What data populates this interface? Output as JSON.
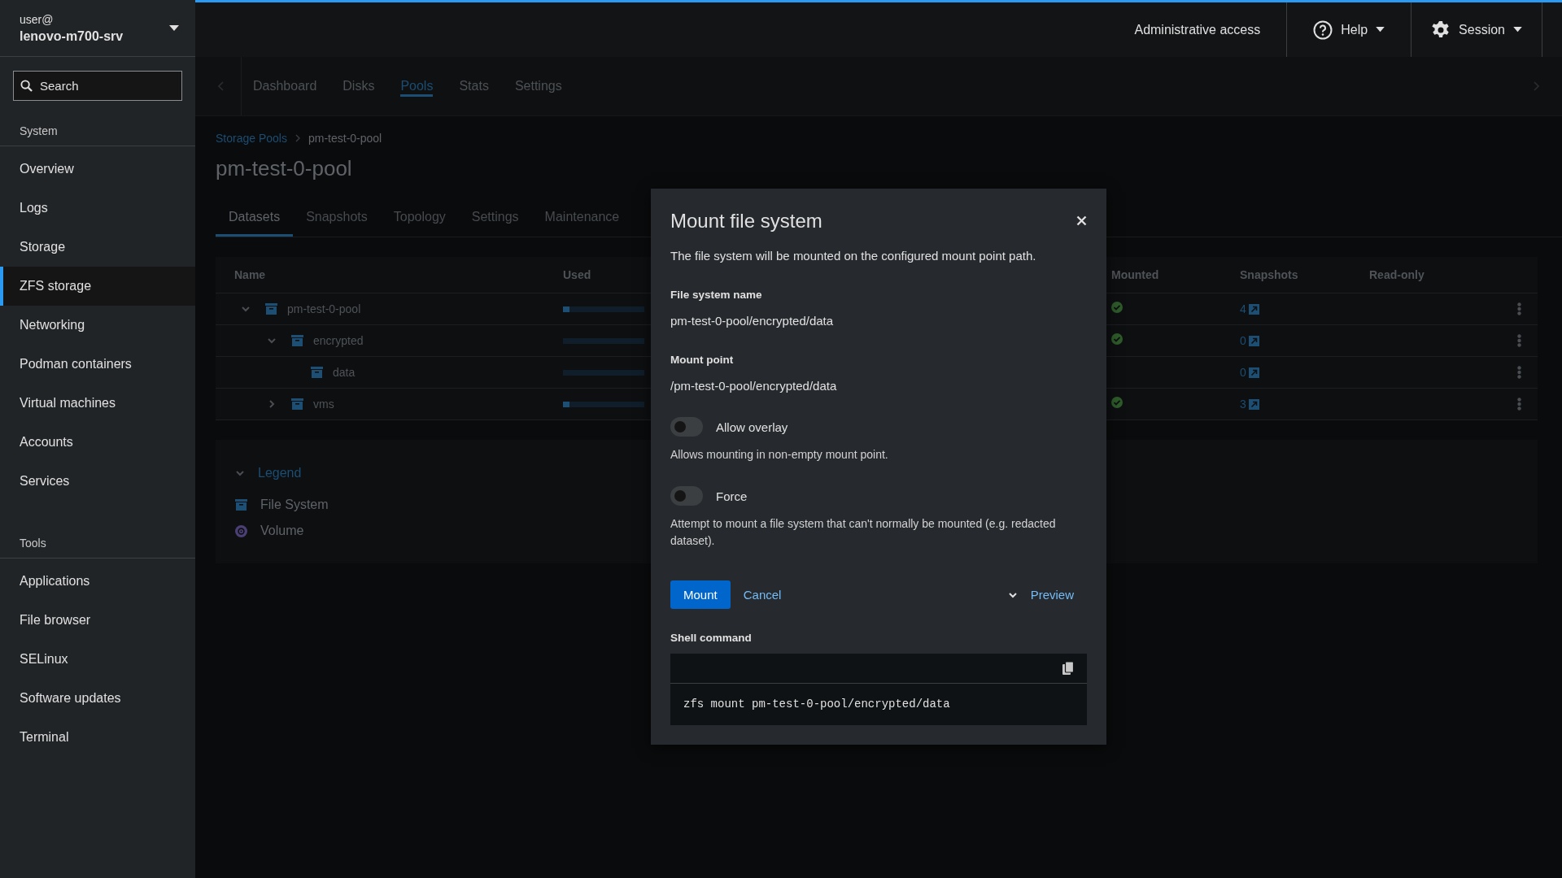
{
  "sidebar": {
    "user": "user@",
    "host": "lenovo-m700-srv",
    "search": {
      "placeholder": "Search"
    },
    "sections": [
      {
        "heading": "System",
        "items": [
          {
            "label": "Overview",
            "selected": false
          },
          {
            "label": "Logs",
            "selected": false
          },
          {
            "label": "Storage",
            "selected": false
          },
          {
            "label": "ZFS storage",
            "selected": true
          },
          {
            "label": "Networking",
            "selected": false
          },
          {
            "label": "Podman containers",
            "selected": false
          },
          {
            "label": "Virtual machines",
            "selected": false
          },
          {
            "label": "Accounts",
            "selected": false
          },
          {
            "label": "Services",
            "selected": false
          }
        ]
      },
      {
        "heading": "Tools",
        "items": [
          {
            "label": "Applications",
            "selected": false
          },
          {
            "label": "File browser",
            "selected": false
          },
          {
            "label": "SELinux",
            "selected": false
          },
          {
            "label": "Software updates",
            "selected": false
          },
          {
            "label": "Terminal",
            "selected": false
          }
        ]
      }
    ]
  },
  "masthead": {
    "access": "Administrative access",
    "help": "Help",
    "session": "Session"
  },
  "nav_tabs": [
    {
      "label": "Dashboard",
      "selected": false
    },
    {
      "label": "Disks",
      "selected": false
    },
    {
      "label": "Pools",
      "selected": true
    },
    {
      "label": "Stats",
      "selected": false
    },
    {
      "label": "Settings",
      "selected": false
    }
  ],
  "breadcrumb": [
    {
      "label": "Storage Pools",
      "kind": "link"
    },
    {
      "label": "pm-test-0-pool",
      "kind": "current"
    }
  ],
  "page_title": "pm-test-0-pool",
  "pool_tabs": [
    {
      "label": "Datasets",
      "selected": true
    },
    {
      "label": "Snapshots",
      "selected": false
    },
    {
      "label": "Topology",
      "selected": false
    },
    {
      "label": "Settings",
      "selected": false
    },
    {
      "label": "Maintenance",
      "selected": false
    }
  ],
  "table": {
    "columns": [
      "Name",
      "Used",
      "Mounted",
      "Snapshots",
      "Read-only"
    ],
    "rows": [
      {
        "name": "pm-test-0-pool",
        "expandable": true,
        "expanded": true,
        "used": {
          "level": 0.08
        },
        "mounted": true,
        "snapshots": "4",
        "children": [
          {
            "name": "encrypted",
            "expandable": true,
            "expanded": true,
            "mounted": true,
            "snapshots": "0",
            "children": [
              {
                "name": "data",
                "expandable": false,
                "mounted": false,
                "snapshots": "0"
              }
            ]
          },
          {
            "name": "vms",
            "expandable": true,
            "expanded": false,
            "used": {
              "level": 0.08
            },
            "mounted": true,
            "snapshots": "3"
          }
        ]
      }
    ]
  },
  "legend": {
    "title": "Legend",
    "expanded": true,
    "items": [
      {
        "kind": "filesystem",
        "label": "File System"
      },
      {
        "kind": "volume",
        "label": "Volume"
      }
    ]
  },
  "dialog": {
    "title": "Mount file system",
    "description": "The file system will be mounted on the configured mount point path.",
    "fields": [
      {
        "label": "File system name",
        "value": "pm-test-0-pool/encrypted/data"
      },
      {
        "label": "Mount point",
        "value": "/pm-test-0-pool/encrypted/data"
      }
    ],
    "toggles": [
      {
        "label": "Allow overlay",
        "on": false,
        "help": "Allows mounting in non-empty mount point."
      },
      {
        "label": "Force",
        "on": false,
        "help": "Attempt to mount a file system that can't normally be mounted (e.g. redacted dataset)."
      }
    ],
    "primary_button": "Mount",
    "cancel_button": "Cancel",
    "preview": {
      "label": "Preview",
      "expanded": true
    },
    "shell": {
      "label": "Shell command",
      "command": "zfs mount pm-test-0-pool/encrypted/data"
    }
  }
}
